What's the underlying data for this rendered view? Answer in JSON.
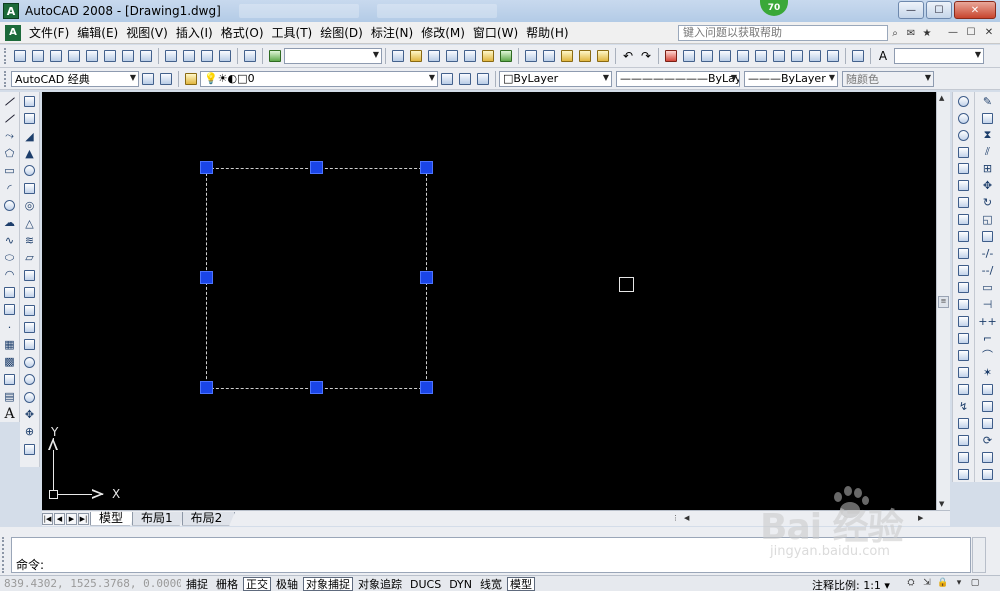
{
  "window": {
    "app_icon": "A",
    "title": "AutoCAD 2008 - [Drawing1.dwg]",
    "badge": "70",
    "controls": {
      "minimize": "—",
      "maximize": "☐",
      "close": "✕"
    }
  },
  "menubar": {
    "items": [
      "文件(F)",
      "编辑(E)",
      "视图(V)",
      "插入(I)",
      "格式(O)",
      "工具(T)",
      "绘图(D)",
      "标注(N)",
      "修改(M)",
      "窗口(W)",
      "帮助(H)"
    ],
    "help_placeholder": "键入问题以获取帮助",
    "doc_controls": {
      "minimize": "—",
      "restore": "☐",
      "close": "✕"
    }
  },
  "toolbar_standard": {
    "combo_value": ""
  },
  "toolbar_layers": {
    "workspace": "AutoCAD 经典",
    "layer": "0",
    "color": "ByLayer",
    "linetype": "ByLayer",
    "lineweight": "ByLayer",
    "plotstyle": "随颜色"
  },
  "canvas": {
    "ucs_x": "X",
    "ucs_y": "Y",
    "background": "#000000",
    "grip_color": "#1a45e8"
  },
  "layout_tabs": [
    "模型",
    "布局1",
    "布局2"
  ],
  "command": {
    "prompt": "命令:"
  },
  "statusbar": {
    "coordinates": "839.4302, 1525.3768, 0.0000",
    "toggles": [
      {
        "label": "捕捉",
        "on": false
      },
      {
        "label": "栅格",
        "on": false
      },
      {
        "label": "正交",
        "on": true
      },
      {
        "label": "极轴",
        "on": false
      },
      {
        "label": "对象捕捉",
        "on": true
      },
      {
        "label": "对象追踪",
        "on": false
      },
      {
        "label": "DUCS",
        "on": false
      },
      {
        "label": "DYN",
        "on": false
      },
      {
        "label": "线宽",
        "on": false
      },
      {
        "label": "模型",
        "on": true
      }
    ],
    "annotation_scale_label": "注释比例: 1:1"
  },
  "watermark": {
    "brand": "Bai 经验",
    "url": "jingyan.baidu.com"
  }
}
